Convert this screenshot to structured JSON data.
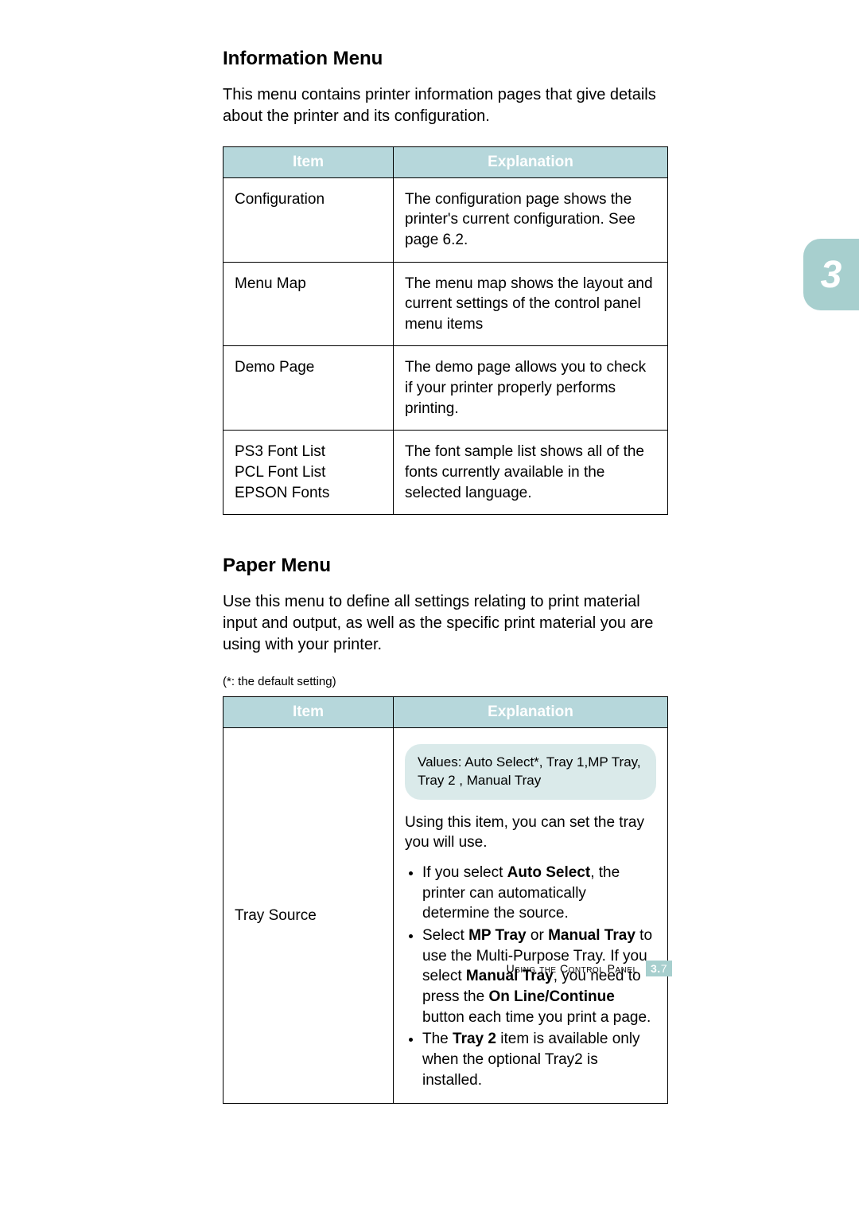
{
  "chapter_tab": "3",
  "sections": {
    "info_menu": {
      "title": "Information Menu",
      "intro": "This menu contains printer information pages that give details about the printer and its configuration.",
      "headers": {
        "col1": "Item",
        "col2": "Explanation"
      },
      "rows": [
        {
          "item": "Configuration",
          "explanation": "The configuration page shows the printer's current configuration. See page 6.2."
        },
        {
          "item": "Menu Map",
          "explanation": "The menu map shows the layout and current settings of the control panel menu items"
        },
        {
          "item": "Demo Page",
          "explanation": "The demo page allows you to check if your printer properly performs printing."
        },
        {
          "item_lines": [
            "PS3 Font List",
            "PCL Font List",
            "EPSON Fonts"
          ],
          "explanation": "The font sample list shows all of the fonts currently available in the selected language."
        }
      ]
    },
    "paper_menu": {
      "title": "Paper Menu",
      "intro": "Use this menu to define all settings relating to print material input and output, as well as the specific print material you are using with your printer.",
      "default_note": "(*: the default setting)",
      "headers": {
        "col1": "Item",
        "col2": "Explanation"
      },
      "row": {
        "item": "Tray Source",
        "values_label": "Values: Auto Select*, Tray 1,MP Tray, Tray 2 , Manual Tray",
        "desc": "Using this item, you can set the tray you will use.",
        "bullets": {
          "b1": {
            "pre": "If you select ",
            "bold1": "Auto Select",
            "post": ", the printer can automatically determine the source."
          },
          "b2": {
            "t1": "Select ",
            "b_mp": "MP Tray",
            "t2": " or ",
            "b_manual": "Manual Tray",
            "t3": " to use the Multi-Purpose Tray. If you select ",
            "b_manual2": "Manual Tray",
            "t4": ", you need to press the ",
            "b_online": "On Line/Continue",
            "t5": " button each time you print a page."
          },
          "b3": {
            "t1": "The ",
            "b_tray2": "Tray 2",
            "t2": " item is available only when the optional Tray2 is installed."
          }
        }
      }
    }
  },
  "footer": {
    "text_caps": "Using the Control Panel",
    "chapter": "3.",
    "page": "7"
  }
}
